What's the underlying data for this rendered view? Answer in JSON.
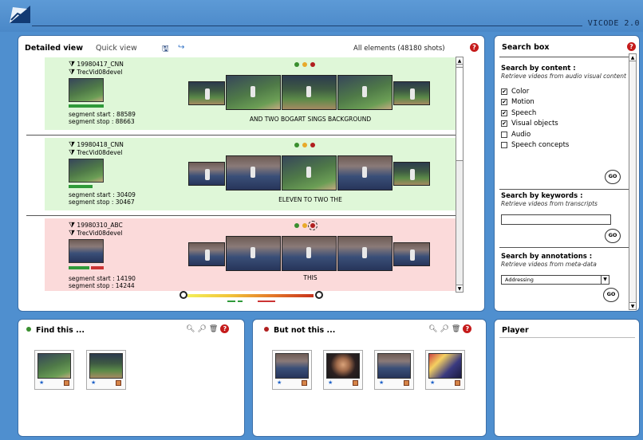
{
  "header": {
    "app_title": "VICODE 2.0"
  },
  "main": {
    "tab_detailed": "Detailed view",
    "tab_quick": "Quick view",
    "all_elements": "All elements (48180 shots)",
    "rows": [
      {
        "id": "19980417_CNN",
        "source": "TrecVid08devel",
        "seg_start": "segment start : 88589",
        "seg_stop": "segment stop : 88663",
        "caption": "AND TWO BOGART SINGS BACKGROUND"
      },
      {
        "id": "19980418_CNN",
        "source": "TrecVid08devel",
        "seg_start": "segment start : 30409",
        "seg_stop": "segment stop : 30467",
        "caption": "ELEVEN TO TWO THE"
      },
      {
        "id": "19980310_ABC",
        "source": "TrecVid08devel",
        "seg_start": "segment start : 14190",
        "seg_stop": "segment stop : 14244",
        "caption": "THIS"
      }
    ]
  },
  "search": {
    "title": "Search box",
    "content_heading": "Search by content :",
    "content_sub": "Retrieve videos from audio visual content",
    "options": [
      {
        "label": "Color",
        "checked": true
      },
      {
        "label": "Motion",
        "checked": true
      },
      {
        "label": "Speech",
        "checked": true
      },
      {
        "label": "Visual objects",
        "checked": true
      },
      {
        "label": "Audio",
        "checked": false
      },
      {
        "label": "Speech concepts",
        "checked": false
      }
    ],
    "go_label": "GO",
    "keywords_heading": "Search by keywords :",
    "keywords_sub": "Retrieve videos from transcripts",
    "annotations_heading": "Search by annotations :",
    "annotations_sub": "Retrieve videos from meta-data",
    "annotation_selected": "Addressing"
  },
  "find_this": {
    "title": "Find this ..."
  },
  "but_not_this": {
    "title": "But not this ..."
  },
  "player": {
    "title": "Player"
  },
  "colors": {
    "green_row": "#dff7d8",
    "red_row": "#fbdada",
    "accent_blue": "#4f8fcf"
  }
}
